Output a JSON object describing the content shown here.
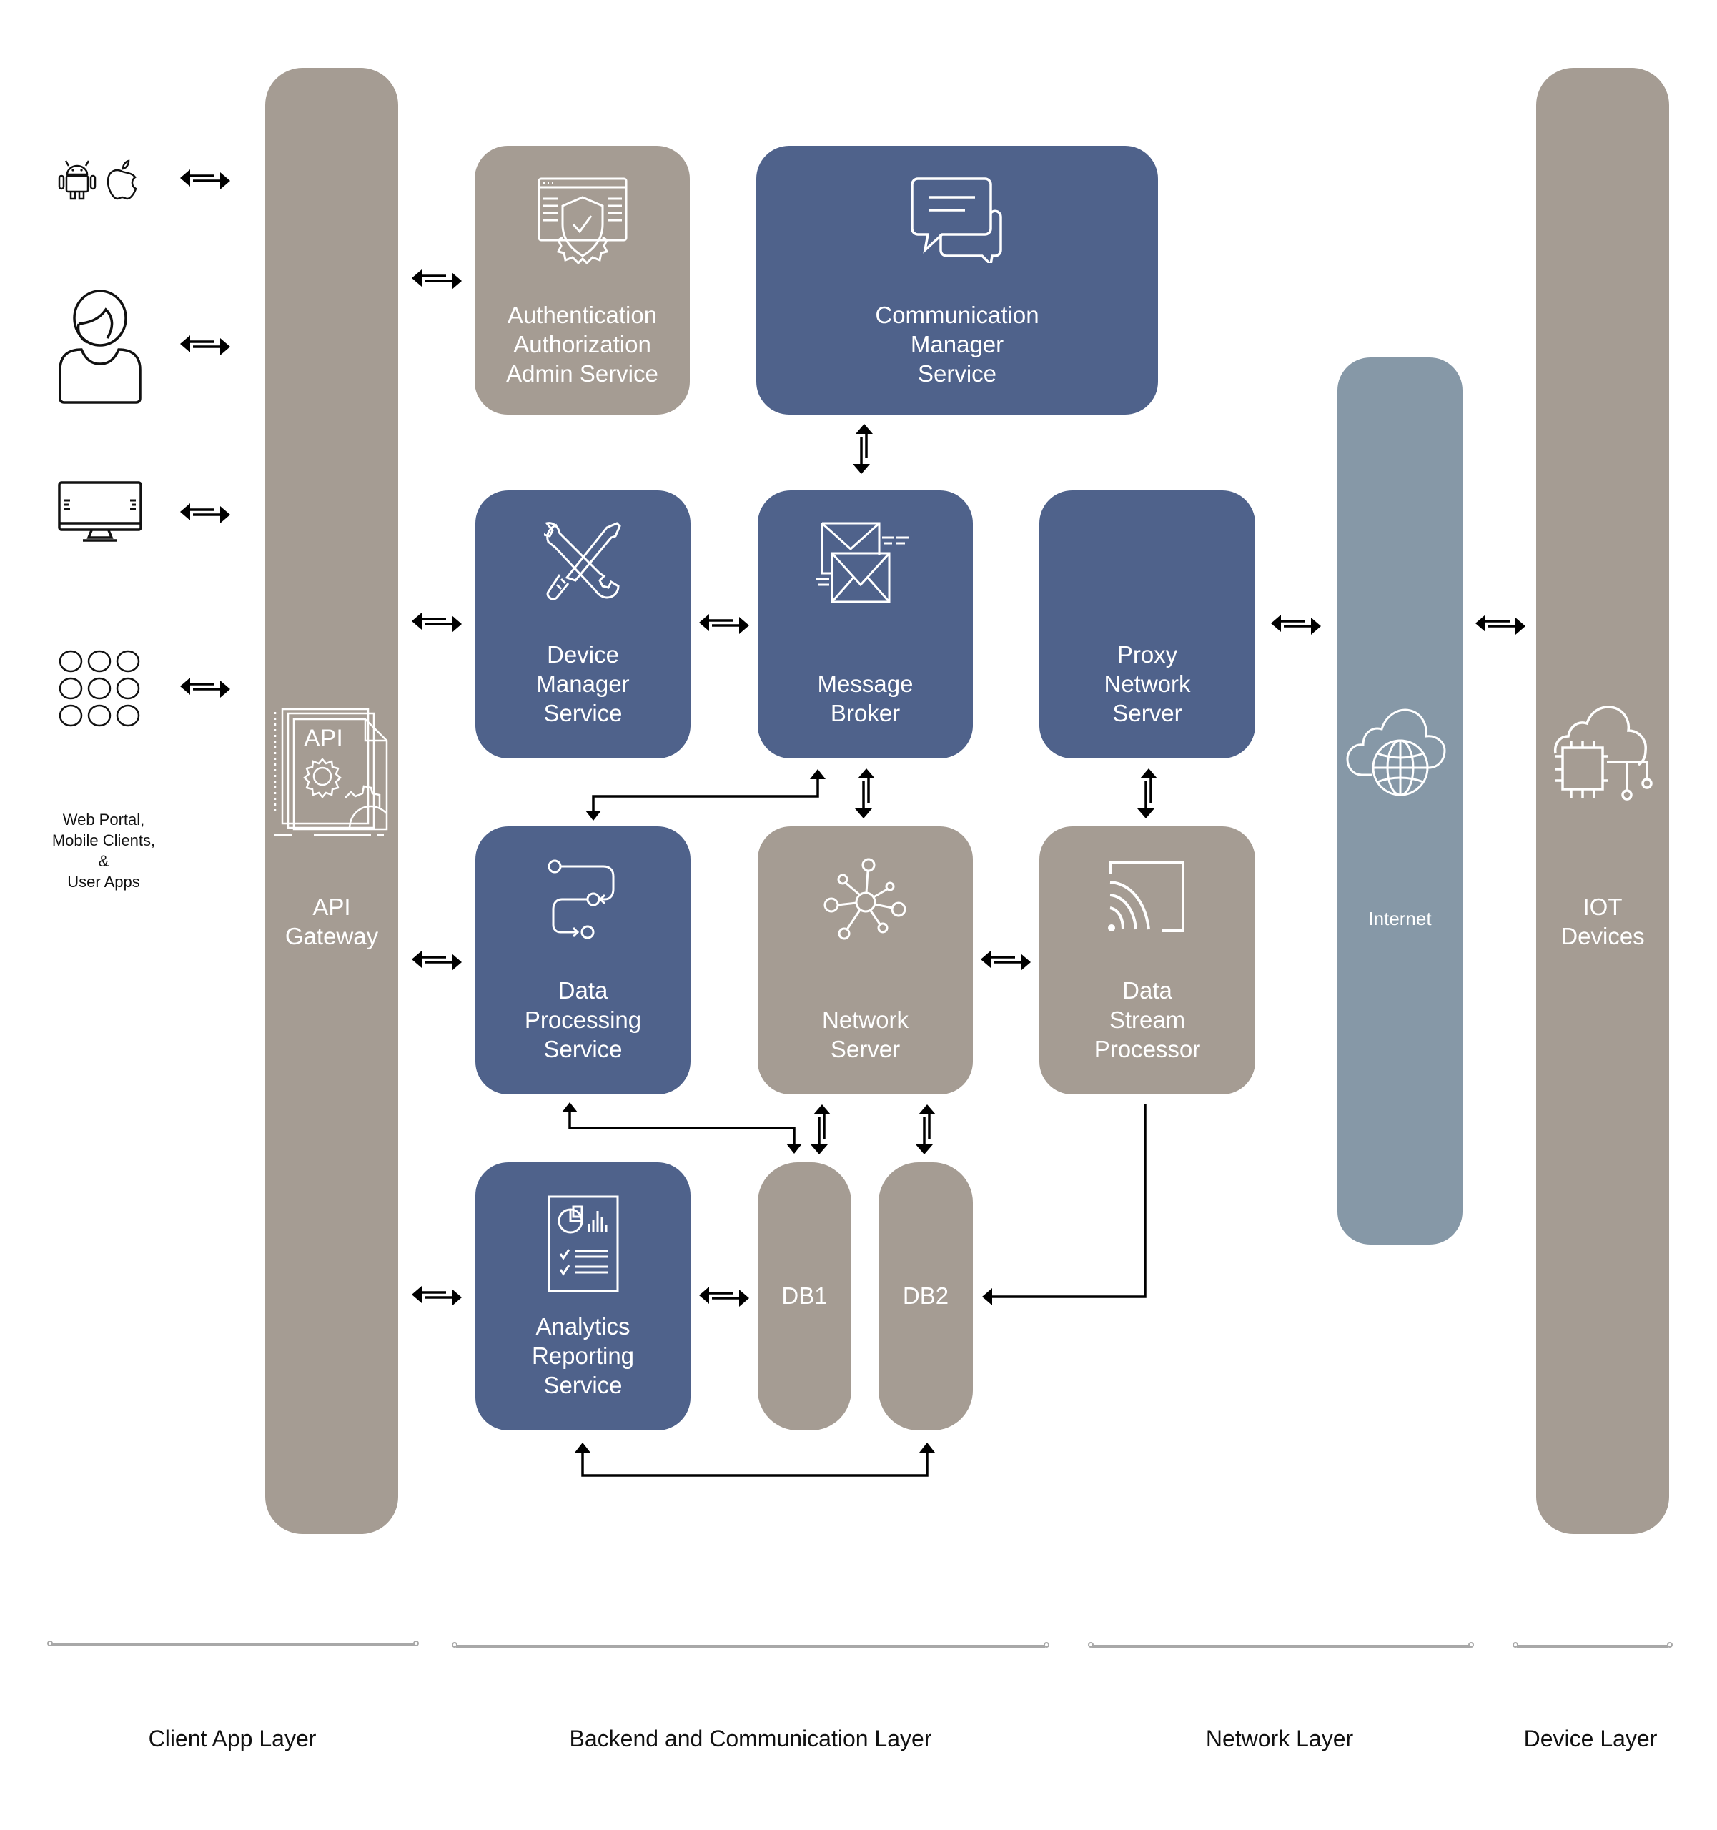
{
  "colors": {
    "tan": "#a59c93",
    "navy": "#4f628b",
    "slate": "#8698a7",
    "connector": "#000000",
    "layer_line": "#a8a8a8"
  },
  "client": {
    "icons": [
      {
        "name": "android-icon"
      },
      {
        "name": "apple-icon"
      },
      {
        "name": "user-icon"
      },
      {
        "name": "monitor-icon"
      },
      {
        "name": "app-grid-icon"
      }
    ],
    "label": "Web Portal,\nMobile Clients,\n&\nUser Apps"
  },
  "api_gateway": {
    "label": "API\nGateway",
    "icon": "api-document-gear-icon",
    "icon_text": "API"
  },
  "services": {
    "auth": {
      "label": "Authentication\nAuthorization\nAdmin Service",
      "icon": "shield-check-browser-icon",
      "color": "tan"
    },
    "comm": {
      "label": "Communication\nManager\nService",
      "icon": "chat-bubbles-icon",
      "color": "navy"
    },
    "device_mgr": {
      "label": "Device\nManager\nService",
      "icon": "tools-icon",
      "color": "navy"
    },
    "msg_broker": {
      "label": "Message\nBroker",
      "icon": "envelopes-icon",
      "color": "navy"
    },
    "proxy": {
      "label": "Proxy\nNetwork\nServer",
      "icon": "",
      "color": "navy"
    },
    "data_proc": {
      "label": "Data\nProcessing\nService",
      "icon": "workflow-icon",
      "color": "navy"
    },
    "network": {
      "label": "Network\nServer",
      "icon": "network-hub-icon",
      "color": "tan"
    },
    "data_stream": {
      "label": "Data\nStream\nProcessor",
      "icon": "stream-signal-icon",
      "color": "tan"
    },
    "analytics": {
      "label": "Analytics\nReporting\nService",
      "icon": "report-chart-icon",
      "color": "navy"
    },
    "db1": {
      "label": "DB1",
      "color": "tan"
    },
    "db2": {
      "label": "DB2",
      "color": "tan"
    }
  },
  "internet": {
    "label": "Internet",
    "icon": "cloud-globe-icon"
  },
  "iot": {
    "label": "IOT\nDevices",
    "icon": "cloud-chip-icon"
  },
  "layers": [
    {
      "label": "Client App Layer"
    },
    {
      "label": "Backend and Communication Layer"
    },
    {
      "label": "Network Layer"
    },
    {
      "label": "Device Layer"
    }
  ],
  "connections": [
    {
      "from": "client-mobile",
      "to": "api_gateway",
      "type": "bidirectional"
    },
    {
      "from": "client-user",
      "to": "api_gateway",
      "type": "bidirectional"
    },
    {
      "from": "client-web",
      "to": "api_gateway",
      "type": "bidirectional"
    },
    {
      "from": "client-apps",
      "to": "api_gateway",
      "type": "bidirectional"
    },
    {
      "from": "api_gateway",
      "to": "auth",
      "type": "bidirectional"
    },
    {
      "from": "api_gateway",
      "to": "device_mgr",
      "type": "bidirectional"
    },
    {
      "from": "api_gateway",
      "to": "data_proc",
      "type": "bidirectional"
    },
    {
      "from": "api_gateway",
      "to": "analytics",
      "type": "bidirectional"
    },
    {
      "from": "comm",
      "to": "msg_broker",
      "type": "bidirectional"
    },
    {
      "from": "device_mgr",
      "to": "msg_broker",
      "type": "bidirectional"
    },
    {
      "from": "msg_broker",
      "to": "data_proc",
      "type": "bidirectional"
    },
    {
      "from": "msg_broker",
      "to": "network",
      "type": "bidirectional"
    },
    {
      "from": "proxy",
      "to": "data_stream",
      "type": "bidirectional"
    },
    {
      "from": "network",
      "to": "data_stream",
      "type": "bidirectional"
    },
    {
      "from": "proxy",
      "to": "internet",
      "type": "bidirectional"
    },
    {
      "from": "internet",
      "to": "iot",
      "type": "bidirectional"
    },
    {
      "from": "data_proc",
      "to": "db1",
      "type": "bidirectional"
    },
    {
      "from": "network",
      "to": "db1",
      "type": "bidirectional"
    },
    {
      "from": "network",
      "to": "db2",
      "type": "bidirectional"
    },
    {
      "from": "analytics",
      "to": "db1",
      "type": "bidirectional"
    },
    {
      "from": "data_stream",
      "to": "db2",
      "type": "directed"
    },
    {
      "from": "db2",
      "to": "analytics",
      "type": "directed"
    }
  ]
}
